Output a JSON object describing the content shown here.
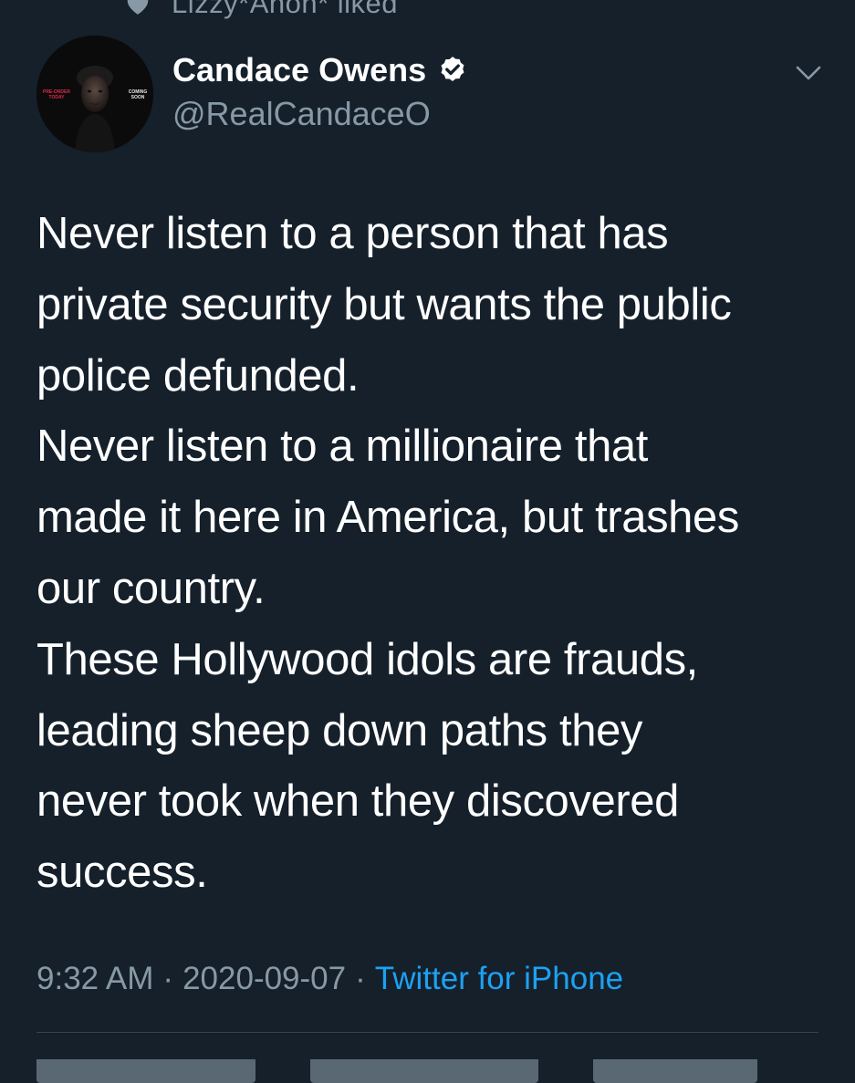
{
  "retweet_context": {
    "text": "Lizzy*Anon* liked",
    "icon": "heart-icon"
  },
  "author": {
    "display_name": "Candace Owens",
    "handle": "@RealCandaceO",
    "verified": true,
    "avatar_texts": {
      "left": [
        "PRE-ORDER",
        "TODAY"
      ],
      "right": [
        "COMING",
        "SOON"
      ]
    }
  },
  "tweet": {
    "lines": [
      "Never listen to a person that has",
      "private security but wants the public",
      "police defunded.",
      "Never listen to a millionaire that",
      "made it here in America, but trashes",
      "our country.",
      "These Hollywood idols are frauds,",
      "leading sheep down paths they",
      "never took when they discovered",
      "success."
    ]
  },
  "meta": {
    "time": "9:32 AM",
    "date": "2020-09-07",
    "separator": "·",
    "source": "Twitter for iPhone"
  },
  "colors": {
    "background": "#15202b",
    "text_primary": "#ffffff",
    "text_secondary": "#8899a6",
    "accent": "#1da1f2",
    "divider": "#38444d"
  }
}
